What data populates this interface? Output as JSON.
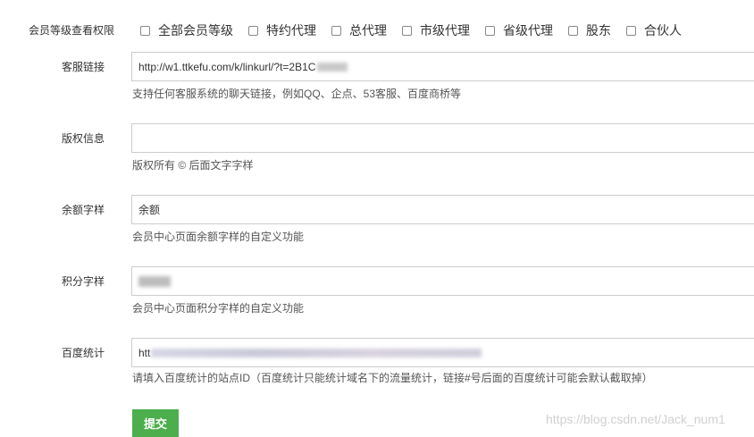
{
  "member_level_permission": {
    "label": "会员等级查看权限",
    "options": [
      {
        "label": "全部会员等级",
        "checked": false
      },
      {
        "label": "特约代理",
        "checked": false
      },
      {
        "label": "总代理",
        "checked": false
      },
      {
        "label": "市级代理",
        "checked": false
      },
      {
        "label": "省级代理",
        "checked": false
      },
      {
        "label": "股东",
        "checked": false
      },
      {
        "label": "合伙人",
        "checked": false
      }
    ]
  },
  "customer_service_link": {
    "label": "客服链接",
    "value": "http://w1.ttkefu.com/k/linkurl/?t=2B1C",
    "help": "支持任何客服系统的聊天链接，例如QQ、企点、53客服、百度商桥等"
  },
  "copyright": {
    "label": "版权信息",
    "value": "",
    "help": "版权所有 © 后面文字字样"
  },
  "balance_text": {
    "label": "余额字样",
    "value": "余额",
    "help": "会员中心页面余额字样的自定义功能"
  },
  "points_text": {
    "label": "积分字样",
    "value": "",
    "help": "会员中心页面积分字样的自定义功能"
  },
  "baidu_stats": {
    "label": "百度统计",
    "value": "htt",
    "help": "请填入百度统计的站点ID（百度统计只能统计域名下的流量统计，链接#号后面的百度统计可能会默认截取掉）"
  },
  "submit_label": "提交",
  "watermark": "https://blog.csdn.net/Jack_num1"
}
